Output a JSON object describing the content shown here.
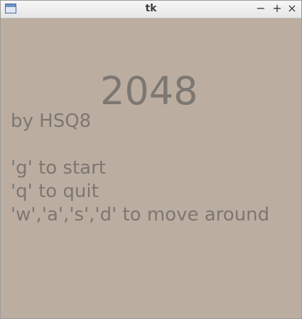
{
  "window": {
    "title": "tk",
    "controls": {
      "minimize": "−",
      "maximize": "+",
      "close": "×"
    }
  },
  "game": {
    "title": "2048",
    "author": "by HSQ8",
    "instructions": [
      "'g' to start",
      "'q' to quit",
      "'w','a','s','d' to move around"
    ]
  },
  "colors": {
    "background": "#bbada0",
    "text": "#7d7771"
  },
  "icons": {
    "app": "window-app-icon"
  }
}
